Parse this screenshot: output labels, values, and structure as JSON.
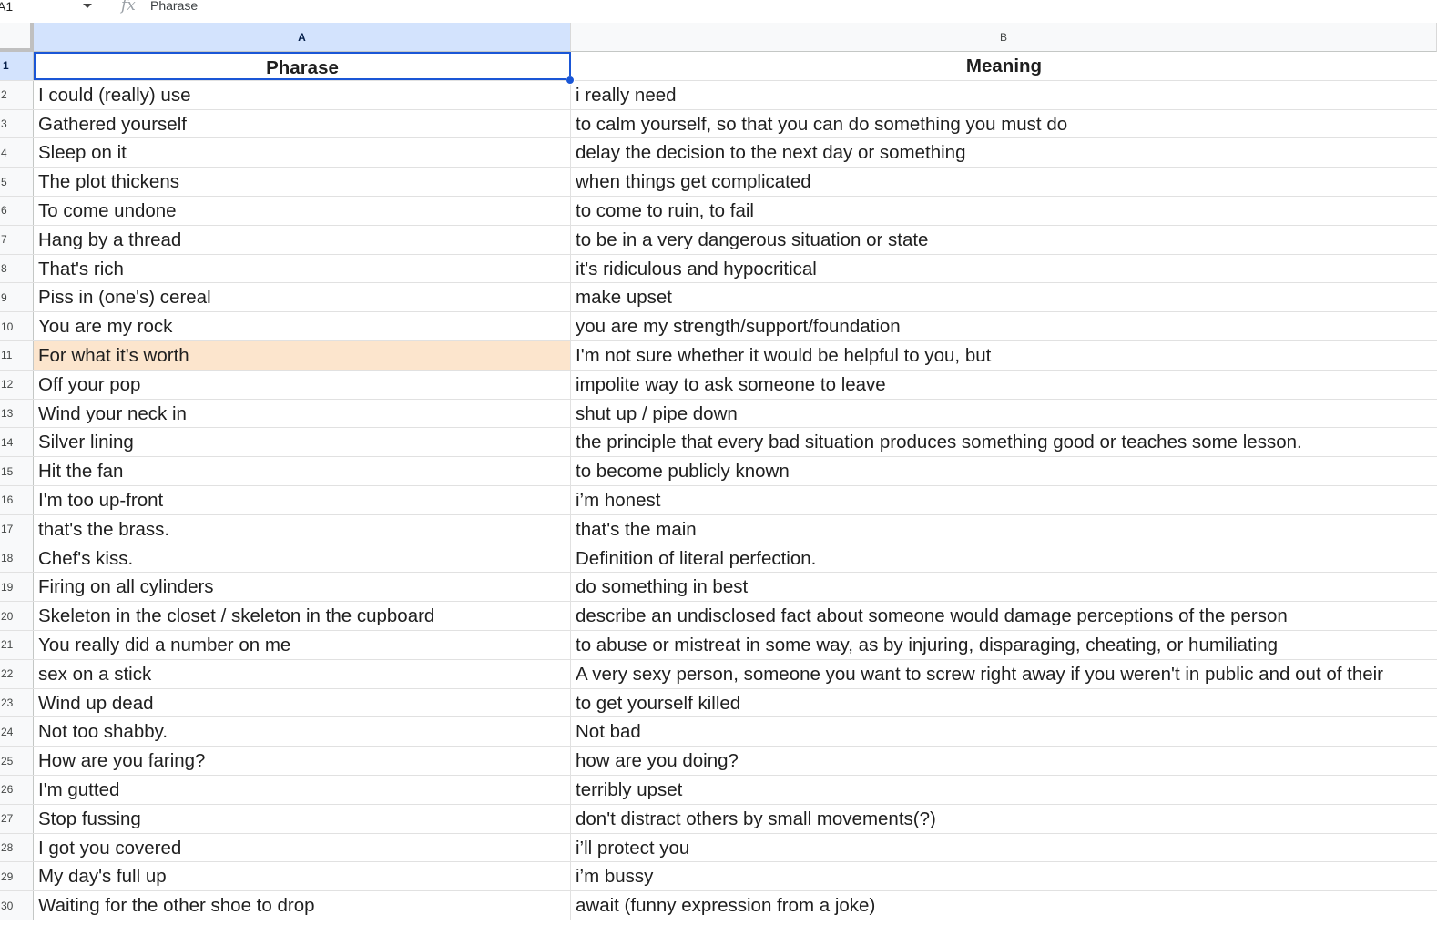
{
  "formula_bar": {
    "cell_ref": "A1",
    "fx_icon": "fx-icon",
    "content": "Pharase"
  },
  "columns": [
    {
      "id": "a",
      "label": "A"
    },
    {
      "id": "b",
      "label": "B"
    }
  ],
  "colors": {
    "highlight": "#fce5cd",
    "selection": "#1a56d6",
    "active_header": "#d3e3fd"
  },
  "rows": [
    {
      "num": "1",
      "a": "Pharase",
      "b": "Meaning"
    },
    {
      "num": "2",
      "a": "I could (really) use",
      "b": "i really need"
    },
    {
      "num": "3",
      "a": "Gathered yourself",
      "b": "to calm yourself, so that you can do something you must do"
    },
    {
      "num": "4",
      "a": "Sleep on it",
      "b": "delay the decision to the next day or something"
    },
    {
      "num": "5",
      "a": "The plot thickens",
      "b": "when things get complicated"
    },
    {
      "num": "6",
      "a": "To come undone",
      "b": "to come to ruin, to fail"
    },
    {
      "num": "7",
      "a": "Hang by a thread",
      "b": "to be in a very dangerous situation or state"
    },
    {
      "num": "8",
      "a": "That's rich",
      "b": "it's ridiculous and hypocritical"
    },
    {
      "num": "9",
      "a": "Piss in (one's) cereal",
      "b": "make upset"
    },
    {
      "num": "10",
      "a": "You are my rock",
      "b": "you are my strength/support/foundation"
    },
    {
      "num": "11",
      "a": "For what it's worth",
      "b": "I'm not sure whether it would be helpful to you, but"
    },
    {
      "num": "12",
      "a": "Off your pop",
      "b": "impolite way to ask someone to leave"
    },
    {
      "num": "13",
      "a": "Wind your neck in",
      "b": "shut up / pipe down"
    },
    {
      "num": "14",
      "a": "Silver lining",
      "b": "the principle that every bad situation produces something good or teaches some lesson."
    },
    {
      "num": "15",
      "a": "Hit the fan",
      "b": "to become publicly known"
    },
    {
      "num": "16",
      "a": "I'm too up-front",
      "b": "i’m honest"
    },
    {
      "num": "17",
      "a": "that's the brass.",
      "b": "that's the main"
    },
    {
      "num": "18",
      "a": "Chef's kiss.",
      "b": "Definition of literal perfection."
    },
    {
      "num": "19",
      "a": "Firing on all cylinders",
      "b": "do something in best"
    },
    {
      "num": "20",
      "a": "Skeleton in the closet / skeleton in the cupboard",
      "b": "describe an undisclosed fact about someone would damage perceptions of the person"
    },
    {
      "num": "21",
      "a": "You really did a number on me",
      "b": "to abuse or mistreat in some way, as by injuring, disparaging, cheating, or humiliating"
    },
    {
      "num": "22",
      "a": "sex on a stick",
      "b": "A very sexy person, someone you want to screw right away if you weren't in public and out of their"
    },
    {
      "num": "23",
      "a": "Wind up dead",
      "b": "to get yourself killed"
    },
    {
      "num": "24",
      "a": "Not too shabby.",
      "b": "Not bad"
    },
    {
      "num": "25",
      "a": "How are you faring?",
      "b": "how are you doing?"
    },
    {
      "num": "26",
      "a": "I'm gutted",
      "b": "terribly upset"
    },
    {
      "num": "27",
      "a": "Stop fussing",
      "b": "don't distract others by small movements(?)"
    },
    {
      "num": "28",
      "a": "I got you covered",
      "b": "i’ll protect you"
    },
    {
      "num": "29",
      "a": "My day's full up",
      "b": "i’m bussy"
    },
    {
      "num": "30",
      "a": "Waiting for the other shoe to drop",
      "b": "await (funny expression from a joke)"
    }
  ]
}
